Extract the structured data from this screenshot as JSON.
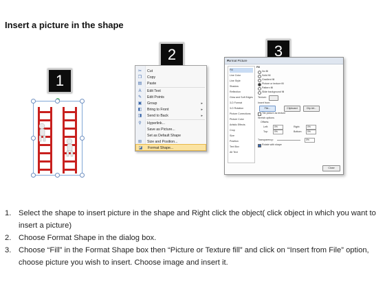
{
  "page": {
    "title": "Insert a picture in the shape"
  },
  "steps_badges": [
    "1",
    "2",
    "3"
  ],
  "context_menu": {
    "items": [
      {
        "icon": "scissors-icon",
        "glyph": "✂",
        "label": "Cut",
        "arrow": ""
      },
      {
        "icon": "copy-icon",
        "glyph": "❐",
        "label": "Copy",
        "arrow": ""
      },
      {
        "icon": "paste-icon",
        "glyph": "▤",
        "label": "Paste",
        "arrow": ""
      },
      {
        "icon": "edit-text-icon",
        "glyph": "A",
        "label": "Edit Text",
        "arrow": ""
      },
      {
        "icon": "edit-points-icon",
        "glyph": "✎",
        "label": "Edit Points",
        "arrow": ""
      },
      {
        "icon": "group-icon",
        "glyph": "▣",
        "label": "Group",
        "arrow": "▸"
      },
      {
        "icon": "bring-front-icon",
        "glyph": "◧",
        "label": "Bring to Front",
        "arrow": "▸"
      },
      {
        "icon": "send-back-icon",
        "glyph": "◨",
        "label": "Send to Back",
        "arrow": "▸"
      },
      {
        "icon": "hyperlink-icon",
        "glyph": "⚲",
        "label": "Hyperlink...",
        "arrow": ""
      },
      {
        "icon": "save-picture-icon",
        "glyph": "",
        "label": "Save as Picture...",
        "arrow": ""
      },
      {
        "icon": "default-shape-icon",
        "glyph": "",
        "label": "Set as Default Shape",
        "arrow": ""
      },
      {
        "icon": "size-position-icon",
        "glyph": "⊞",
        "label": "Size and Position...",
        "arrow": ""
      },
      {
        "icon": "format-shape-icon",
        "glyph": "◪",
        "label": "Format Shape...",
        "arrow": ""
      }
    ]
  },
  "dialog": {
    "title": "Format Picture",
    "close": "✕",
    "categories": [
      "Fill",
      "Line Color",
      "Line Style",
      "Shadow",
      "Reflection",
      "Glow and Soft Edges",
      "3-D Format",
      "3-D Rotation",
      "Picture Corrections",
      "Picture Color",
      "Artistic Effects",
      "Crop",
      "Size",
      "Position",
      "Text Box",
      "Alt Text"
    ],
    "section": "Fill",
    "fill_options": [
      "No fill",
      "Solid fill",
      "Gradient fill",
      "Picture or texture fill",
      "Pattern fill",
      "Slide background fill"
    ],
    "texture_label": "Texture:",
    "insert_from": "Insert from:",
    "file_button": "File...",
    "clipboard_button": "Clipboard",
    "clipart_button": "Clip Art...",
    "tile_label": "Tile picture as texture",
    "stretch_label": "Stretch options",
    "offsets_label": "Offsets:",
    "left_label": "Left:",
    "left_val": "0%",
    "right_label": "Right:",
    "right_val": "0%",
    "top_label": "Top:",
    "top_val": "0%",
    "bottom_label": "Bottom:",
    "bottom_val": "0%",
    "transparency_label": "Transparency:",
    "transparency_val": "0%",
    "rotate_label": "Rotate with shape",
    "close_button": "Close"
  },
  "instructions": [
    {
      "num": "1.",
      "text": "Select the shape to insert picture in the shape and Right click the object( click object in which you want to insert a picture)"
    },
    {
      "num": "2.",
      "text": "Choose Format Shape in the dialog box."
    },
    {
      "num": "3.",
      "text": "Choose “Fill” in the Format Shape box then “Picture or Texture fill”  and click on “Insert from File” option, choose picture you wish to insert. Choose image and insert it."
    }
  ],
  "colors": {
    "ladder": "#c8201e",
    "badge": "#0c0c0c",
    "highlight": "#fbe3a1",
    "selection": "#7fa7d6"
  }
}
